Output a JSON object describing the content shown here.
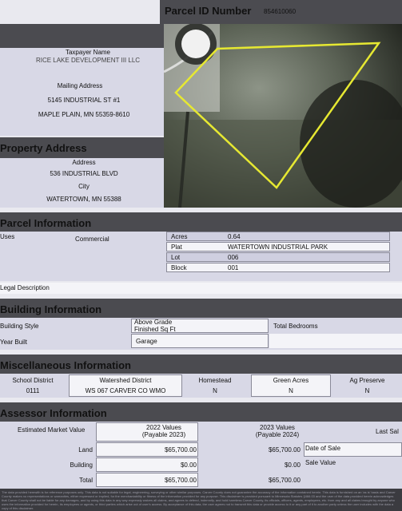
{
  "parcel": {
    "label": "Parcel ID Number",
    "value": "854610060"
  },
  "taxpayer": {
    "name_label": "Taxpayer Name",
    "name": "RICE LAKE DEVELOPMENT III LLC",
    "mailing_label": "Mailing Address",
    "street": "5145 INDUSTRIAL ST #1",
    "city": "MAPLE PLAIN, MN 55359-8610"
  },
  "property_address": {
    "title": "Property Address",
    "address_label": "Address",
    "address": "536 INDUSTRIAL BLVD",
    "city_label": "City",
    "city": "WATERTOWN, MN 55388"
  },
  "parcel_info": {
    "title": "Parcel Information",
    "uses_label": "Uses",
    "uses": "Commercial",
    "rows": [
      {
        "label": "Acres",
        "value": "0.64"
      },
      {
        "label": "Plat",
        "value": "WATERTOWN INDUSTRIAL PARK"
      },
      {
        "label": "Lot",
        "value": "006"
      },
      {
        "label": "Block",
        "value": "001"
      }
    ],
    "legal_label": "Legal Description"
  },
  "building": {
    "title": "Building Information",
    "style_label": "Building Style",
    "above_grade_label": "Above Grade",
    "finished_label": "Finished Sq Ft",
    "bedrooms_label": "Total Bedrooms",
    "year_label": "Year Built",
    "garage_label": "Garage"
  },
  "misc": {
    "title": "Miscellaneous Information",
    "cols": [
      {
        "label": "School District",
        "value": "0111"
      },
      {
        "label": "Watershed District",
        "value": "WS 067 CARVER CO WMO"
      },
      {
        "label": "Homestead",
        "value": "N"
      },
      {
        "label": "Green Acres",
        "value": "N"
      },
      {
        "label": "Ag Preserve",
        "value": "N"
      }
    ]
  },
  "assessor": {
    "title": "Assessor Information",
    "emv_label": "Estimated Market Value",
    "col2022_a": "2022 Values",
    "col2022_b": "(Payable 2023)",
    "col2023_a": "2023 Values",
    "col2023_b": "(Payable 2024)",
    "last_sale": "Last Sal",
    "rows": [
      {
        "label": "Land",
        "v2022": "$65,700.00",
        "v2023": "$65,700.00",
        "side": "Date of Sale"
      },
      {
        "label": "Building",
        "v2022": "$0.00",
        "v2023": "$0.00",
        "side": "Sale Value"
      },
      {
        "label": "Total",
        "v2022": "$65,700.00",
        "v2023": "$65,700.00",
        "side": ""
      }
    ],
    "disclaimer": "The data provided herewith is for reference purposes only. This data is not suitable for legal, engineering, surveying or other similar purposes. Carver County does not guarantee the accuracy of the information contained herein. This data is furnished on an 'as is' basis and Carver County makes no representations or warranties, either expressed or implied, for the merchantability or fitness of the information provided for any purpose. This disclaimer is provided pursuant to Minnesota Statutes §466.03 and the user of the data provided herein acknowledges that Carver County shall not be liable for any damages, and by using this data in any way expressly waives all claims, and agrees to defend, indemnify, and hold harmless Carver County, its officials, officers, agents, employees, etc. from any and all claims brought by anyone who uses the information provided for herein, its employees or agents, or third parties which arise out of user's access. By acceptance of this data, the user agrees not to transmit this data or provide access to it or any part of it to another party unless the user includes with the data a copy of this disclaimer."
  }
}
